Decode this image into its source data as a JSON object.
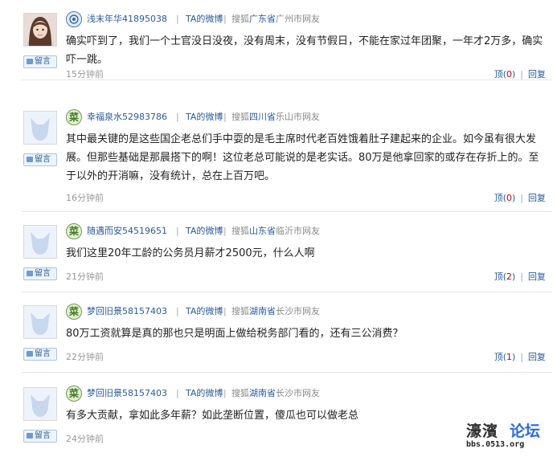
{
  "ui": {
    "liuyan_label": "留言",
    "reply_label": "回复",
    "top_label": "顶",
    "ta_from": "TA的微博",
    "separator": "|",
    "open_paren": "(",
    "close_paren": ")"
  },
  "comments": [
    {
      "username": "浅末年华41895038",
      "badge": "weibo-blue",
      "loc_prefix": "搜狐",
      "province": "广东省",
      "loc_suffix": "广州市网友",
      "text": "确实吓到了，我们一个士官没日没夜，没有周末，没有节假日，不能在家过年团聚，一年才2万多，确实吓一跳。",
      "time": "15分钟前",
      "votes": "0",
      "avatar": "photo"
    },
    {
      "username": "幸福泉水52983786",
      "badge": "cai-green",
      "badge_char": "菜",
      "loc_prefix": "搜狐",
      "province": "四川省",
      "loc_suffix": "乐山市网友",
      "text": "其中最关键的是这些国企老总们手中耍的是毛主席时代老百姓饿着肚子建起来的企业。如今虽有很大发展。但那些基础是那晨搭下的啊！这位老总可能说的是老实话。80万是他拿回家的或存在存折上的。至于以外的开消嘛，没有统计，总在上百万吧。",
      "time": "16分钟前",
      "votes": "0",
      "avatar": "default"
    },
    {
      "username": "随遇而安54519651",
      "badge": "cai-green",
      "badge_char": "菜",
      "loc_prefix": "搜狐",
      "province": "山东省",
      "loc_suffix": "临沂市网友",
      "text": "我们这里20年工龄的公务员月薪才2500元，什么人啊",
      "time": "21分钟前",
      "votes": "2",
      "avatar": "default"
    },
    {
      "username": "梦回旧景58157403",
      "badge": "cai-green",
      "badge_char": "菜",
      "loc_prefix": "搜狐",
      "province": "湖南省",
      "loc_suffix": "长沙市网友",
      "text": "80万工资就算是真的那也只是明面上做给税务部门看的，还有三公消费？",
      "time": "22分钟前",
      "votes": "1",
      "avatar": "default"
    },
    {
      "username": "梦回旧景58157403",
      "badge": "cai-green",
      "badge_char": "菜",
      "loc_prefix": "搜狐",
      "province": "湖南省",
      "loc_suffix": "长沙市网友",
      "text": "有多大贡献，拿如此多年薪？如此垄断位置，傻瓜也可以做老总",
      "time": "24分钟前",
      "votes": null,
      "avatar": "default"
    }
  ],
  "watermark": {
    "main": "濠濱",
    "luntan": "论坛",
    "url": "bbs.0513.org"
  },
  "colors": {
    "link": "#2a5a9c",
    "vote_count": "#cc0000",
    "badge_green": "#3f7a1e",
    "watermark_blue": "#2e6bd3"
  }
}
